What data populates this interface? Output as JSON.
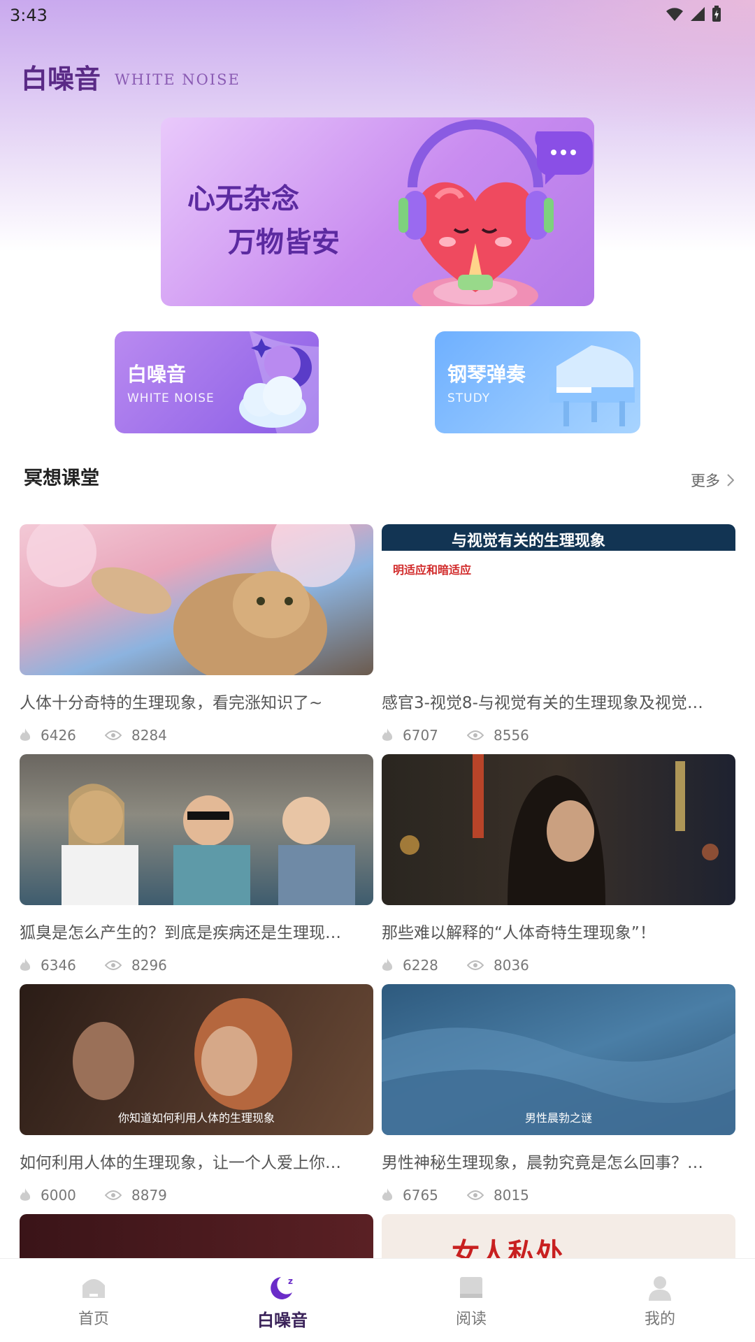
{
  "status_bar": {
    "time": "3:43"
  },
  "header": {
    "title_cn": "白噪音",
    "title_en": "WHITE NOISE"
  },
  "banner": {
    "line1": "心无杂念",
    "line2": "万物皆安"
  },
  "quick_cards": [
    {
      "title": "白噪音",
      "subtitle": "WHITE NOISE"
    },
    {
      "title": "钢琴弹奏",
      "subtitle": "STUDY"
    }
  ],
  "section": {
    "title": "冥想课堂",
    "more": "更多"
  },
  "articles": [
    {
      "title": "人体十分奇特的生理现象，看完涨知识了~",
      "likes": "6426",
      "views": "8284",
      "thumb_header": "",
      "thumb_sub": "",
      "thumb_caption": ""
    },
    {
      "title": "感官3-视觉8-与视觉有关的生理现象及视觉…",
      "likes": "6707",
      "views": "8556",
      "thumb_header": "与视觉有关的生理现象",
      "thumb_sub": "明适应和暗适应",
      "thumb_caption": ""
    },
    {
      "title": "狐臭是怎么产生的？到底是疾病还是生理现…",
      "likes": "6346",
      "views": "8296",
      "thumb_header": "",
      "thumb_sub": "",
      "thumb_caption": ""
    },
    {
      "title": "那些难以解释的“人体奇特生理现象”！",
      "likes": "6228",
      "views": "8036",
      "thumb_header": "",
      "thumb_sub": "",
      "thumb_caption": ""
    },
    {
      "title": "如何利用人体的生理现象，让一个人爱上你…",
      "likes": "6000",
      "views": "8879",
      "thumb_header": "",
      "thumb_sub": "",
      "thumb_caption": "你知道如何利用人体的生理现象"
    },
    {
      "title": "男性神秘生理现象，晨勃究竟是怎么回事？…",
      "likes": "6765",
      "views": "8015",
      "thumb_header": "",
      "thumb_sub": "",
      "thumb_caption": "男性晨勃之谜"
    },
    {
      "title": "",
      "likes": "",
      "views": "",
      "thumb_header": "",
      "thumb_sub": "",
      "thumb_caption": ""
    },
    {
      "title": "",
      "likes": "",
      "views": "",
      "thumb_header": "",
      "thumb_sub": "",
      "thumb_caption": "女人私处"
    }
  ],
  "bottom_nav": [
    {
      "label": "首页",
      "icon": "home-icon",
      "active": false
    },
    {
      "label": "白噪音",
      "icon": "moon-icon",
      "active": true
    },
    {
      "label": "阅读",
      "icon": "book-icon",
      "active": false
    },
    {
      "label": "我的",
      "icon": "user-icon",
      "active": false
    }
  ],
  "colors": {
    "accent": "#5a2a86",
    "purple_card": "#8a5de6",
    "blue_card": "#6fb0ff"
  }
}
